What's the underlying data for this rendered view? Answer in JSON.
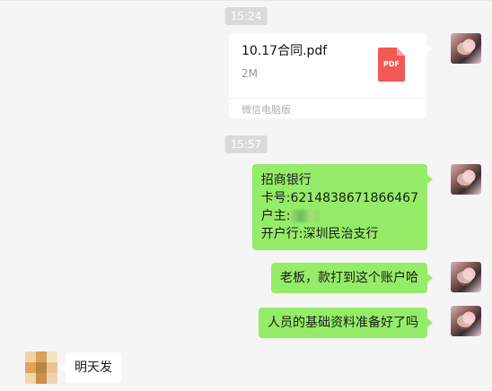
{
  "timestamps": [
    "15:24",
    "15:57"
  ],
  "file": {
    "name": "10.17合同.pdf",
    "size": "2M",
    "icon_label": "PDF",
    "footer": "微信电脑版"
  },
  "messages": {
    "bank": {
      "line1": "招商银行",
      "line2": "卡号:6214838671866467",
      "line3": "户主:",
      "line4": "开户行:深圳民治支行"
    },
    "msg2": "老板，款打到这个账户哈",
    "msg3": "人员的基础资料准备好了吗",
    "reply": "明天发"
  },
  "colors": {
    "background": "#f5f5f5",
    "self_bubble": "#95ec69",
    "other_bubble": "#ffffff",
    "pdf_red": "#f15a55",
    "timestamp_bg": "#dadada"
  }
}
